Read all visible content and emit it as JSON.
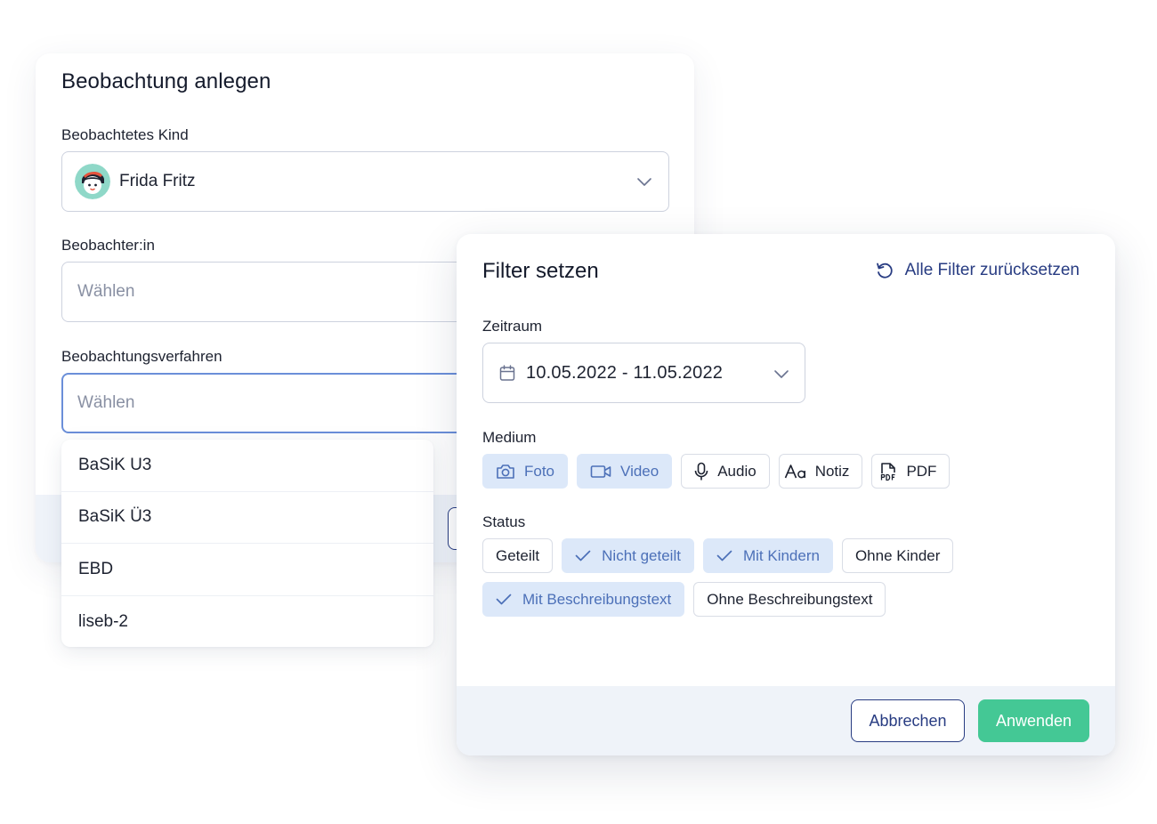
{
  "observation_form": {
    "title": "Beobachtung anlegen",
    "child_label": "Beobachtetes Kind",
    "child_value": "Frida Fritz",
    "observer_label": "Beobachter:in",
    "observer_placeholder": "Wählen",
    "method_label": "Beobachtungsverfahren",
    "method_placeholder": "Wählen",
    "method_options": [
      "BaSiK U3",
      "BaSiK Ü3",
      "EBD",
      "liseb-2"
    ]
  },
  "filter_dialog": {
    "title": "Filter setzen",
    "reset_label": "Alle Filter zurücksetzen",
    "period_label": "Zeitraum",
    "period_value": "10.05.2022 - 11.05.2022",
    "medium_label": "Medium",
    "medium_chips": [
      {
        "label": "Foto",
        "icon": "camera-icon",
        "selected": true
      },
      {
        "label": "Video",
        "icon": "video-icon",
        "selected": true
      },
      {
        "label": "Audio",
        "icon": "microphone-icon",
        "selected": false
      },
      {
        "label": "Notiz",
        "icon": "text-icon",
        "selected": false
      },
      {
        "label": "PDF",
        "icon": "pdf-icon",
        "selected": false
      }
    ],
    "status_label": "Status",
    "status_chips": [
      {
        "label": "Geteilt",
        "selected": false
      },
      {
        "label": "Nicht geteilt",
        "selected": true
      },
      {
        "label": "Mit Kindern",
        "selected": true
      },
      {
        "label": "Ohne Kinder",
        "selected": false
      },
      {
        "label": "Mit Beschreibungstext",
        "selected": true
      },
      {
        "label": "Ohne Beschreibungstext",
        "selected": false
      }
    ],
    "cancel_label": "Abbrechen",
    "apply_label": "Anwenden"
  },
  "colors": {
    "primary": "#283c82",
    "accent_green": "#44c895",
    "chip_selected_bg": "#dce8f9",
    "chip_selected_text": "#4c70b8",
    "footer_bg": "#eff3f9"
  }
}
